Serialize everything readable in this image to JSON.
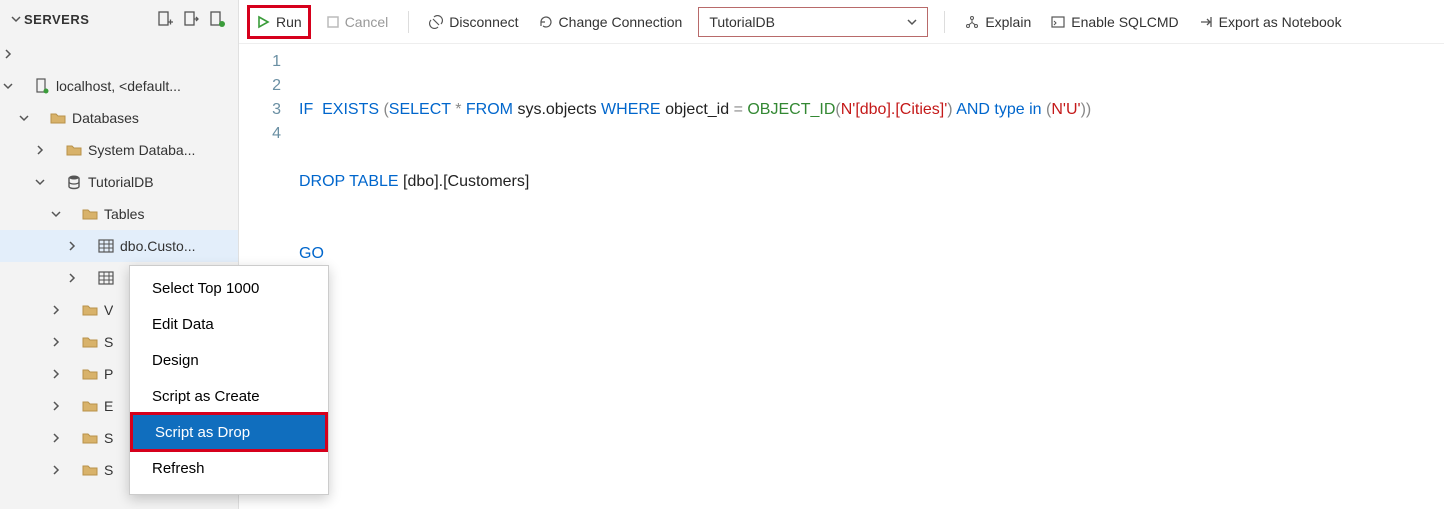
{
  "sidebar": {
    "title": "SERVERS",
    "nodes": {
      "server": "localhost, <default...",
      "databases": "Databases",
      "sysdb": "System Databa...",
      "tutorialdb": "TutorialDB",
      "tables": "Tables",
      "custo": "dbo.Custo...",
      "trunc": "",
      "v": "V",
      "s1": "S",
      "p": "P",
      "e": "E",
      "s2": "S",
      "s3": "S"
    }
  },
  "toolbar": {
    "run": "Run",
    "cancel": "Cancel",
    "disconnect": "Disconnect",
    "change_connection": "Change Connection",
    "db": "TutorialDB",
    "explain": "Explain",
    "enable_sqlcmd": "Enable SQLCMD",
    "export_notebook": "Export as Notebook"
  },
  "editor": {
    "lines": [
      "1",
      "2",
      "3",
      "4"
    ]
  },
  "code_tokens": {
    "l1": {
      "if": "IF",
      "exists": "EXISTS",
      "select": "SELECT",
      "star": "*",
      "from": "FROM",
      "sysobj": "sys.objects",
      "where": "WHERE",
      "objid": "object_id",
      "eq": "=",
      "objfn": "OBJECT_ID",
      "s1": "N'[dbo].[Cities]'",
      "and": "AND",
      "type": "type",
      "in": "in",
      "s2": "N'U'"
    },
    "l2": {
      "drop": "DROP",
      "table": "TABLE",
      "ident": "[dbo].[Customers]"
    },
    "l3": {
      "go": "GO"
    }
  },
  "context_menu": {
    "select_top": "Select Top 1000",
    "edit_data": "Edit Data",
    "design": "Design",
    "script_create": "Script as Create",
    "script_drop": "Script as Drop",
    "refresh": "Refresh"
  }
}
